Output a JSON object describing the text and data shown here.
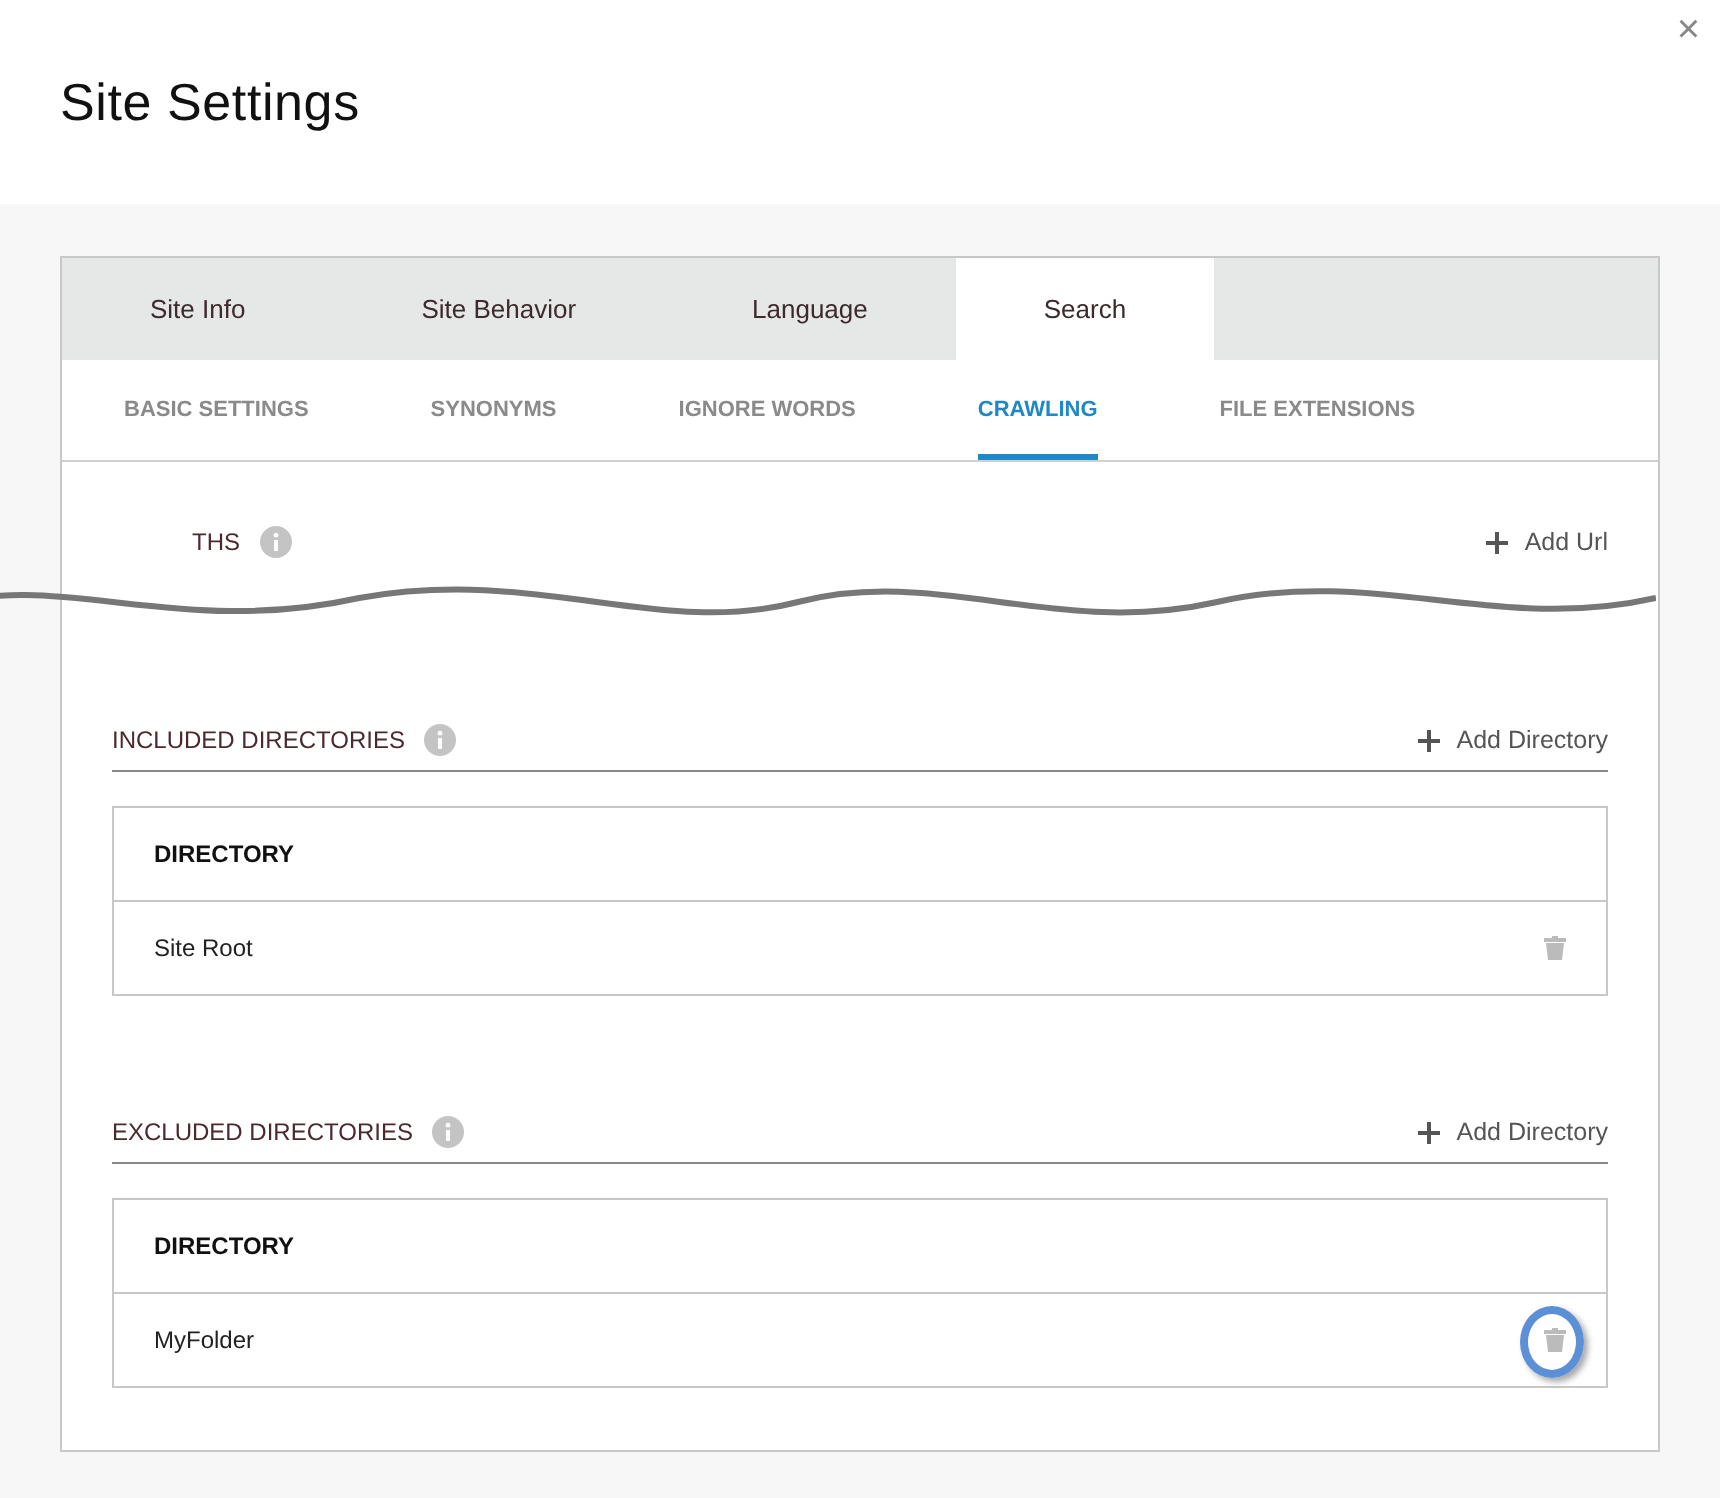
{
  "dialog": {
    "title": "Site Settings",
    "close_label": "×"
  },
  "tabs": [
    {
      "label": "Site Info",
      "selected": false
    },
    {
      "label": "Site Behavior",
      "selected": false
    },
    {
      "label": "Language",
      "selected": false
    },
    {
      "label": "Search",
      "selected": true
    }
  ],
  "subtabs": [
    {
      "label": "BASIC SETTINGS",
      "selected": false
    },
    {
      "label": "SYNONYMS",
      "selected": false
    },
    {
      "label": "IGNORE WORDS",
      "selected": false
    },
    {
      "label": "CRAWLING",
      "selected": true
    },
    {
      "label": "FILE EXTENSIONS",
      "selected": false
    }
  ],
  "cut_section": {
    "heading_fragment": "THS",
    "action": "Add Url"
  },
  "sections": [
    {
      "heading": "INCLUDED DIRECTORIES",
      "action": "Add Directory",
      "column": "DIRECTORY",
      "rows": [
        {
          "name": "Site Root",
          "highlighted": false
        }
      ]
    },
    {
      "heading": "EXCLUDED DIRECTORIES",
      "action": "Add Directory",
      "column": "DIRECTORY",
      "rows": [
        {
          "name": "MyFolder",
          "highlighted": true
        }
      ]
    }
  ]
}
